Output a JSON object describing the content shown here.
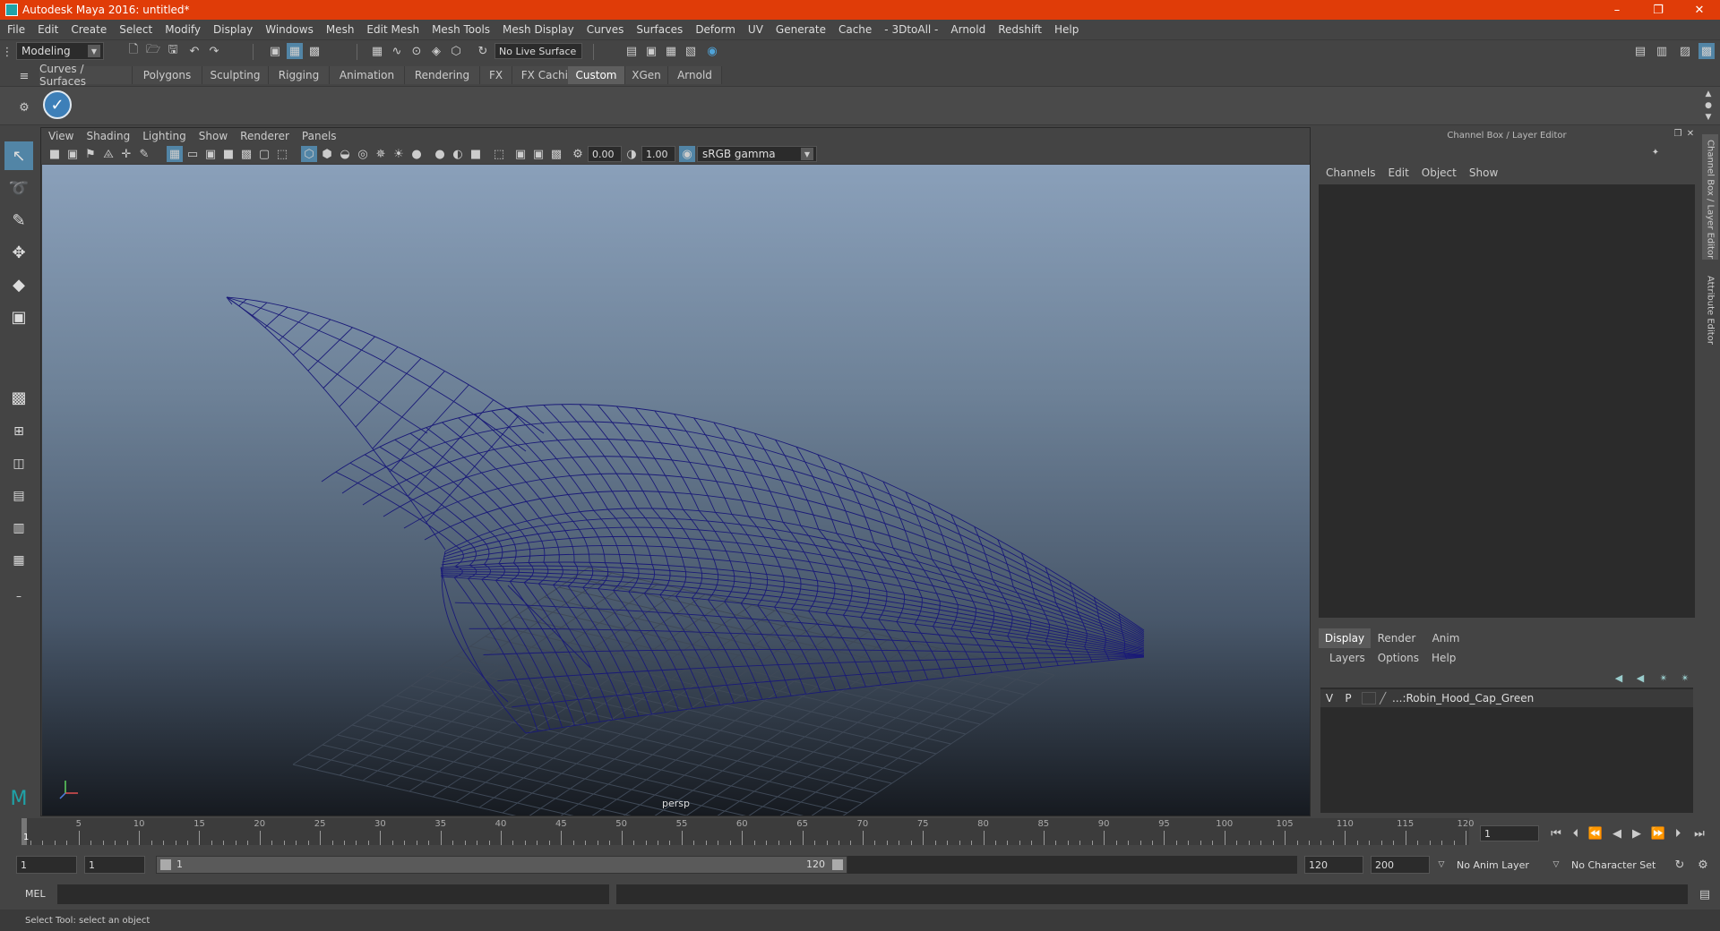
{
  "window": {
    "title": "Autodesk Maya 2016: untitled*"
  },
  "menu": [
    "File",
    "Edit",
    "Create",
    "Select",
    "Modify",
    "Display",
    "Windows",
    "Mesh",
    "Edit Mesh",
    "Mesh Tools",
    "Mesh Display",
    "Curves",
    "Surfaces",
    "Deform",
    "UV",
    "Generate",
    "Cache",
    "- 3DtoAll -",
    "Arnold",
    "Redshift",
    "Help"
  ],
  "statusline": {
    "mode": "Modeling",
    "live_surface": "No Live Surface"
  },
  "shelf": {
    "tabs": [
      "Curves / Surfaces",
      "Polygons",
      "Sculpting",
      "Rigging",
      "Animation",
      "Rendering",
      "FX",
      "FX Caching",
      "Custom",
      "XGen",
      "Arnold"
    ],
    "active_tab": "Custom"
  },
  "viewport": {
    "menu": [
      "View",
      "Shading",
      "Lighting",
      "Show",
      "Renderer",
      "Panels"
    ],
    "exposure": "0.00",
    "gamma": "1.00",
    "colorspace": "sRGB gamma",
    "camera_label": "persp",
    "wire_color": "#1a1a78"
  },
  "channelbox": {
    "title": "Channel Box / Layer Editor",
    "menu": [
      "Channels",
      "Edit",
      "Object",
      "Show"
    ]
  },
  "layers": {
    "tabs": [
      "Display",
      "Render",
      "Anim"
    ],
    "active_tab": "Display",
    "menu": [
      "Layers",
      "Options",
      "Help"
    ],
    "rows": [
      {
        "v": "V",
        "p": "P",
        "name": "...:Robin_Hood_Cap_Green"
      }
    ]
  },
  "sidetabs": [
    "Channel Box / Layer Editor",
    "Attribute Editor"
  ],
  "timeline": {
    "labels": [
      "5",
      "10",
      "15",
      "20",
      "25",
      "30",
      "35",
      "40",
      "45",
      "50",
      "55",
      "60",
      "65",
      "70",
      "75",
      "80",
      "85",
      "90",
      "95",
      "100",
      "105",
      "110",
      "115",
      "120"
    ],
    "start_marker": "1",
    "current_frame": "1"
  },
  "range": {
    "start": "1",
    "playback_start": "1",
    "slider_start": "1",
    "slider_end": "120",
    "playback_end": "120",
    "end": "200",
    "anim_layer": "No Anim Layer",
    "character_set": "No Character Set"
  },
  "command": {
    "label": "MEL"
  },
  "help": {
    "text": "Select Tool: select an object"
  }
}
